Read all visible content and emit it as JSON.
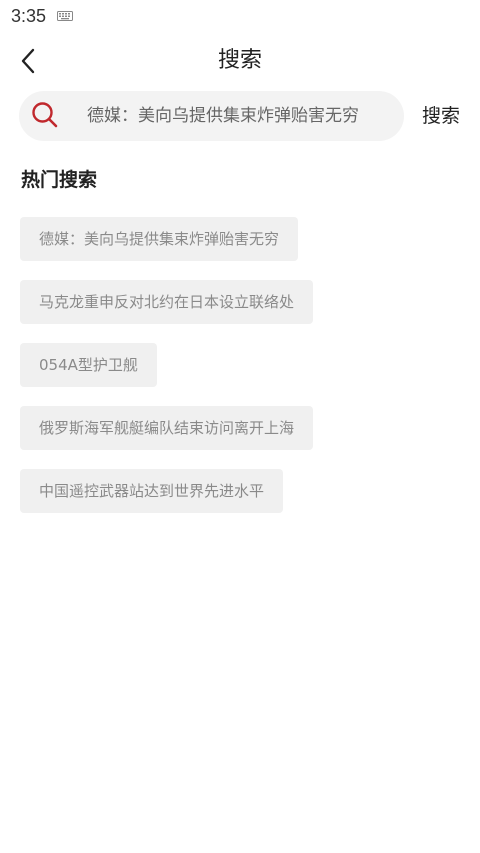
{
  "status_bar": {
    "time": "3:35",
    "keyboard_icon": "keyboard-icon"
  },
  "nav": {
    "back_icon": "chevron-left-icon",
    "title": "搜索"
  },
  "search": {
    "placeholder": "德媒：美向乌提供集束炸弹贻害无穷",
    "icon": "search-icon",
    "icon_color": "#c0282d",
    "button_label": "搜索"
  },
  "hot_search": {
    "title": "热门搜索",
    "items": [
      {
        "label": "德媒：美向乌提供集束炸弹贻害无穷"
      },
      {
        "label": "马克龙重申反对北约在日本设立联络处"
      },
      {
        "label": "054A型护卫舰"
      },
      {
        "label": "俄罗斯海军舰艇编队结束访问离开上海"
      },
      {
        "label": "中国遥控武器站达到世界先进水平"
      }
    ]
  }
}
